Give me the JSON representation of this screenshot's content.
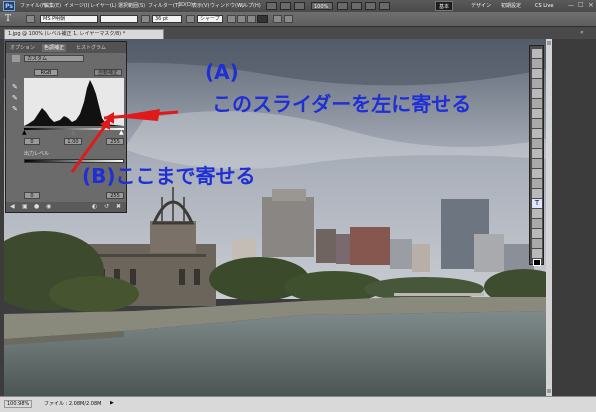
{
  "app": {
    "logo": "Ps",
    "menus": [
      "ファイル(F)",
      "編集(E)",
      "イメージ(I)",
      "レイヤー(L)",
      "選択範囲(S)",
      "フィルター(T)",
      "3D(D)",
      "表示(V)",
      "ウィンドウ(W)",
      "ヘルプ(H)"
    ],
    "zoom": "100%",
    "workspaces": [
      "基本",
      "デザイン",
      "初期設定"
    ],
    "cs_live": "CS Live"
  },
  "options": {
    "font_family": "MS P明朝",
    "font_size": "36 pt",
    "antialias": "シャープ",
    "text_color": "#333333"
  },
  "document": {
    "tab_title": "1.jpg @ 100% (レベル補正 1, レイヤーマスク/8) *"
  },
  "status": {
    "zoom": "100.98%",
    "file_info": "ファイル : 2.08M/2.08M"
  },
  "levels_panel": {
    "tabs": [
      "オプション",
      "色調補正",
      "ヒストグラム"
    ],
    "preset": "カスタム",
    "channel": "RGB",
    "auto_button": "自動補正",
    "input_values": [
      "0",
      "1.00",
      "255"
    ],
    "output_label": "出力レベル",
    "output_values": [
      "0",
      "255"
    ]
  },
  "annotations": {
    "a_label": "(A)",
    "a_text": "このスライダーを左に寄せる",
    "b_text": "(B)ここまで寄せる",
    "color": "#1f2fd6",
    "arrow_color": "#e01a1a"
  },
  "tool_icons": [
    "move-icon",
    "marquee-icon",
    "lasso-icon",
    "quick-select-icon",
    "crop-icon",
    "eyedropper-icon",
    "healing-icon",
    "brush-icon",
    "clone-stamp-icon",
    "history-brush-icon",
    "eraser-icon",
    "gradient-icon",
    "blur-icon",
    "dodge-icon",
    "pen-icon",
    "type-icon",
    "path-select-icon",
    "shape-icon",
    "3d-rotate-icon",
    "hand-icon",
    "zoom-icon"
  ]
}
